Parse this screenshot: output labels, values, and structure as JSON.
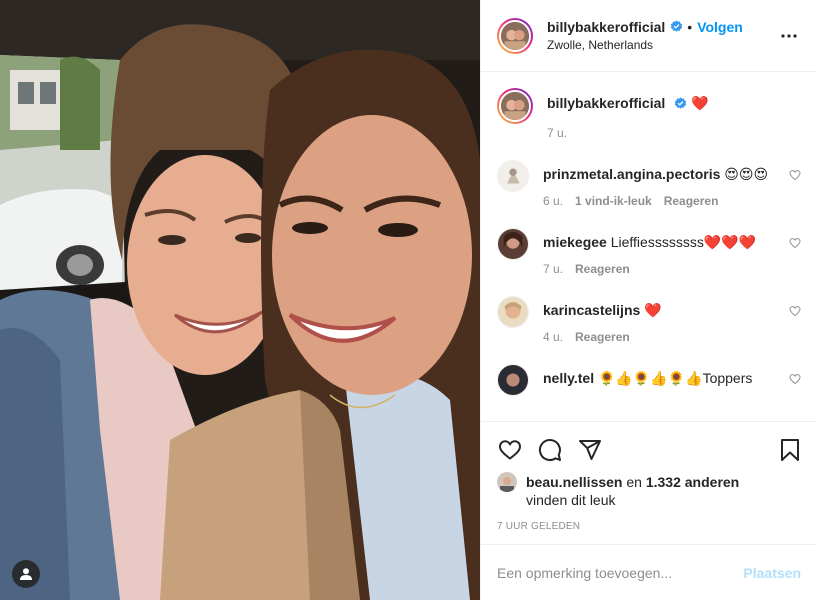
{
  "post": {
    "author": "billybakkerofficial",
    "follow_label": "Volgen",
    "dot": "•",
    "location": "Zwolle, Netherlands",
    "caption": {
      "username": "billybakkerofficial",
      "text": "❤️",
      "age": "7 u."
    }
  },
  "comments": [
    {
      "username": "prinzmetal.angina.pectoris",
      "text": "😍😍😍",
      "age": "6 u.",
      "likes": "1 vind-ik-leuk",
      "reply": "Reageren"
    },
    {
      "username": "miekegee",
      "text": "Lieffiessssssss❤️❤️❤️",
      "age": "7 u.",
      "likes": "",
      "reply": "Reageren"
    },
    {
      "username": "karincastelijns",
      "text": "❤️",
      "age": "4 u.",
      "likes": "",
      "reply": "Reageren"
    },
    {
      "username": "nelly.tel",
      "text": "🌻👍🌻👍🌻👍Toppers",
      "age": "",
      "likes": "",
      "reply": ""
    }
  ],
  "likes": {
    "liker": "beau.nellissen",
    "connector": "en",
    "others": "1.332 anderen",
    "suffix": "vinden dit leuk"
  },
  "timestamp": "7 uur geleden",
  "composer": {
    "placeholder": "Een opmerking toevoegen...",
    "post_label": "Plaatsen"
  },
  "icons": [
    "heart-icon",
    "comment-icon",
    "share-icon",
    "save-icon",
    "more-options-icon",
    "verified-icon",
    "user-tag-icon"
  ],
  "colors": {
    "follow": "#0095f6",
    "post_disabled": "#b2dffc",
    "meta": "#8e8e8e",
    "verified": "#3897f0"
  }
}
